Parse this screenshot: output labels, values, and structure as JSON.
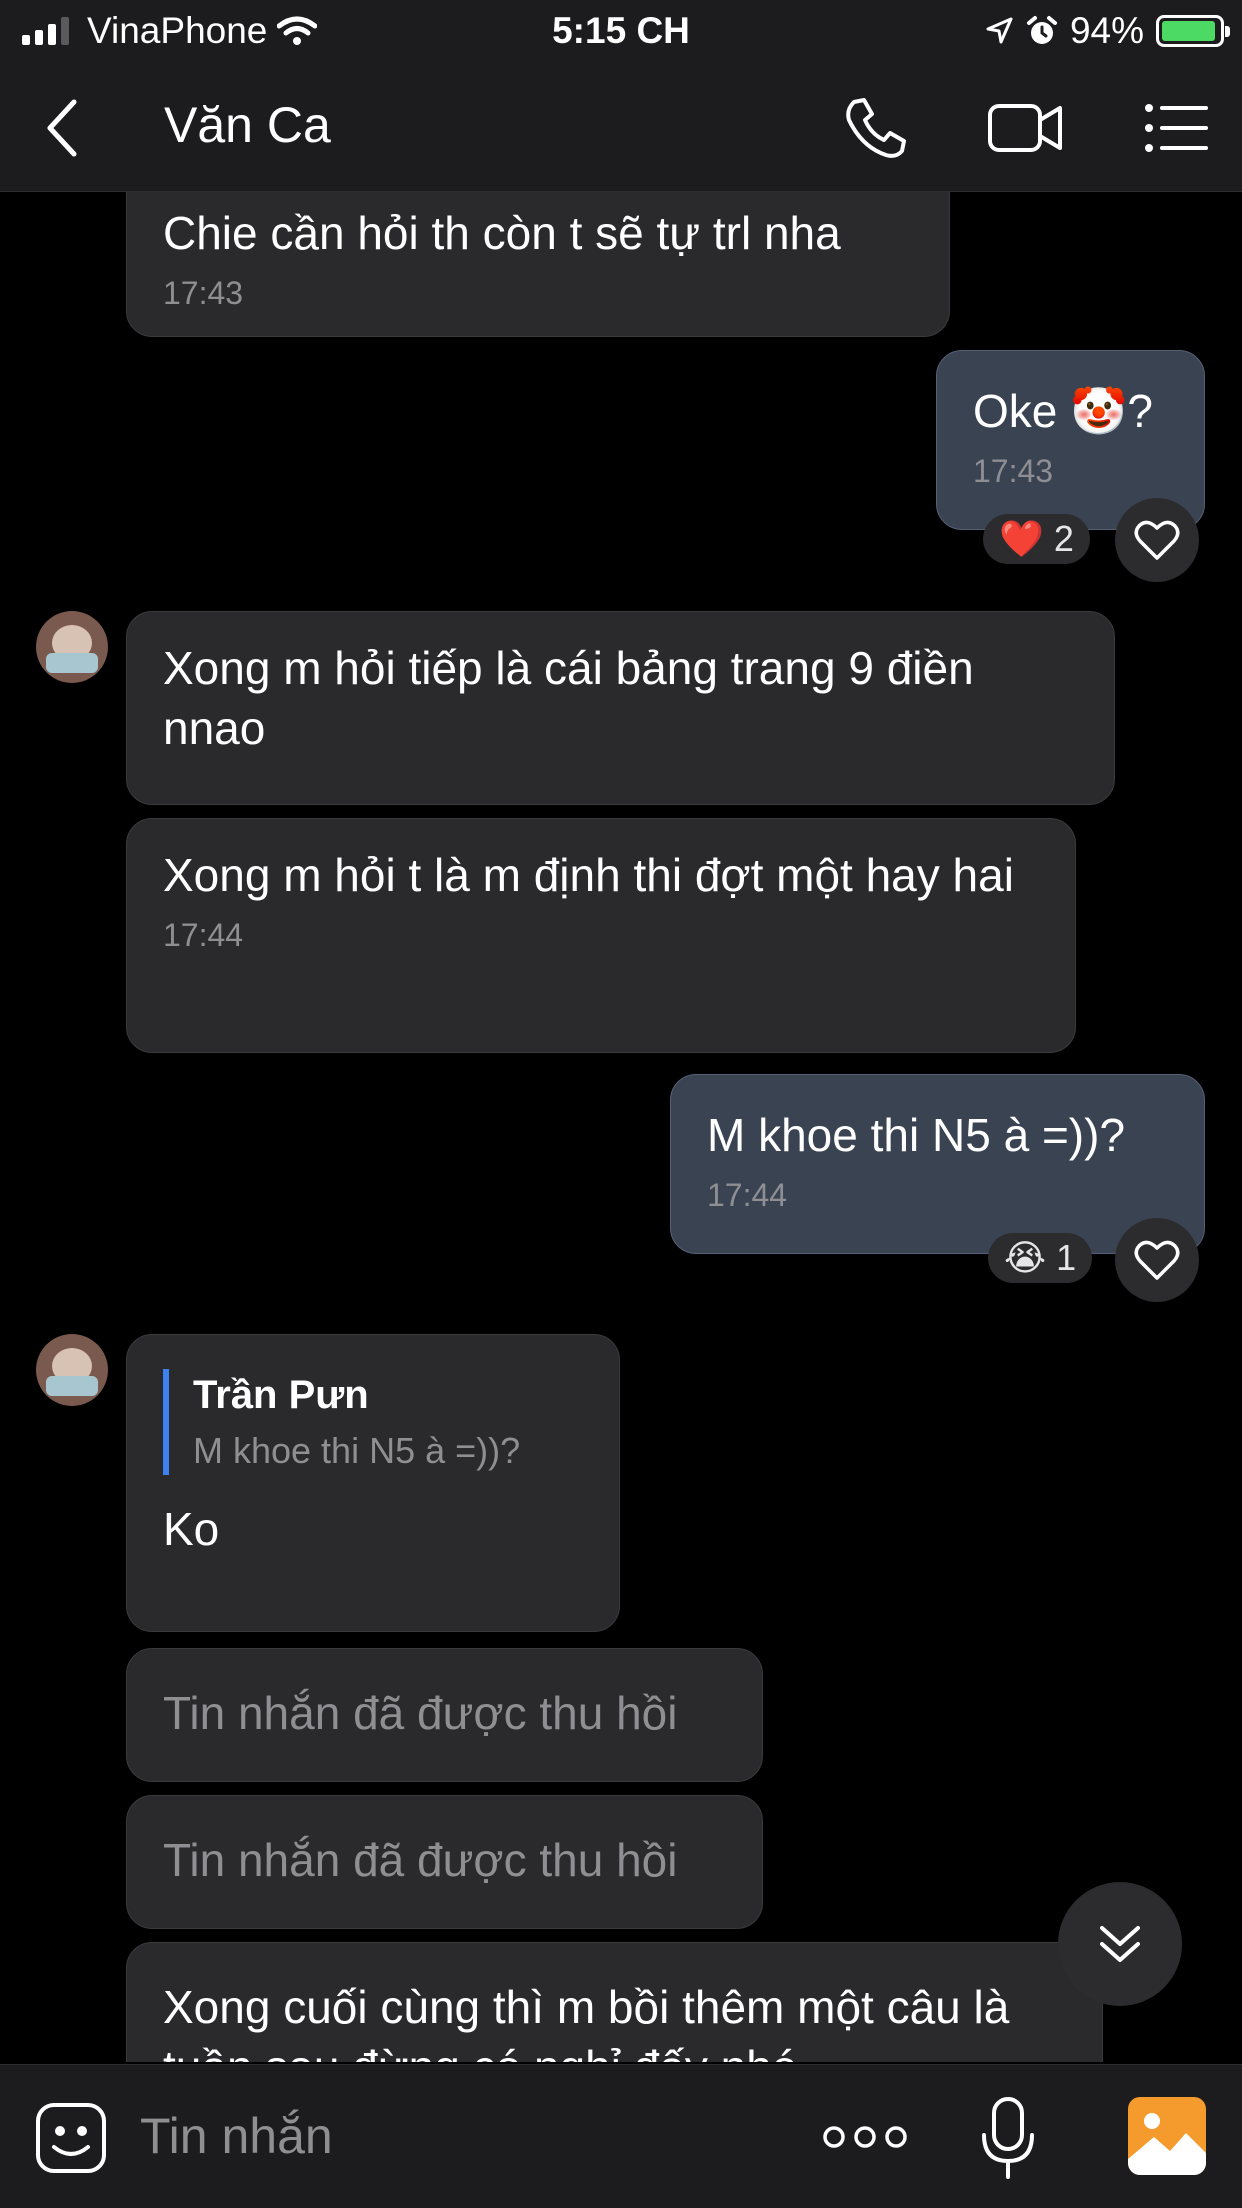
{
  "status_bar": {
    "carrier": "VinaPhone",
    "time": "5:15 CH",
    "battery": "94%",
    "battery_level": 0.94
  },
  "header": {
    "title": "Văn Ca",
    "icons": [
      "back-icon",
      "phone-icon",
      "video-icon",
      "menu-list-icon"
    ]
  },
  "messages": [
    {
      "text": "Chie cần hỏi th còn t sẽ tự trl nha",
      "time": "17:43"
    },
    {
      "text": "Oke 🤡?",
      "time": "17:43",
      "reaction_emoji": "❤️",
      "reaction_count": "2"
    },
    {
      "text": "Xong m hỏi tiếp là cái bảng trang 9 điền nnao"
    },
    {
      "text": "Xong m hỏi t là m định thi đợt một hay hai",
      "time": "17:44"
    },
    {
      "text": "M khoe thi N5 à =))?",
      "time": "17:44",
      "reaction_emoji": "😭",
      "reaction_count": "1"
    },
    {
      "quote_name": "Trần Pưn",
      "quote_text": "M khoe thi N5 à =))?",
      "text": "Ko"
    },
    {
      "text": "Tin nhắn đã được thu hồi"
    },
    {
      "text": "Tin nhắn đã được thu hồi"
    },
    {
      "text": "Xong cuối cùng thì m bồi thêm một câu là tuần sau đừng có nghỉ đấy nhé"
    }
  ],
  "composer": {
    "placeholder": "Tin nhắn",
    "icons": [
      "emoji-sticker-icon",
      "more-options-icon",
      "microphone-icon",
      "photo-icon"
    ]
  },
  "colors": {
    "background": "#000000",
    "bar": "#1c1c1e",
    "incoming_bubble": "#2a2a2c",
    "outgoing_bubble": "#3a4352",
    "quote_bar": "#3d82f0",
    "photo_button": "#f59a2c"
  }
}
